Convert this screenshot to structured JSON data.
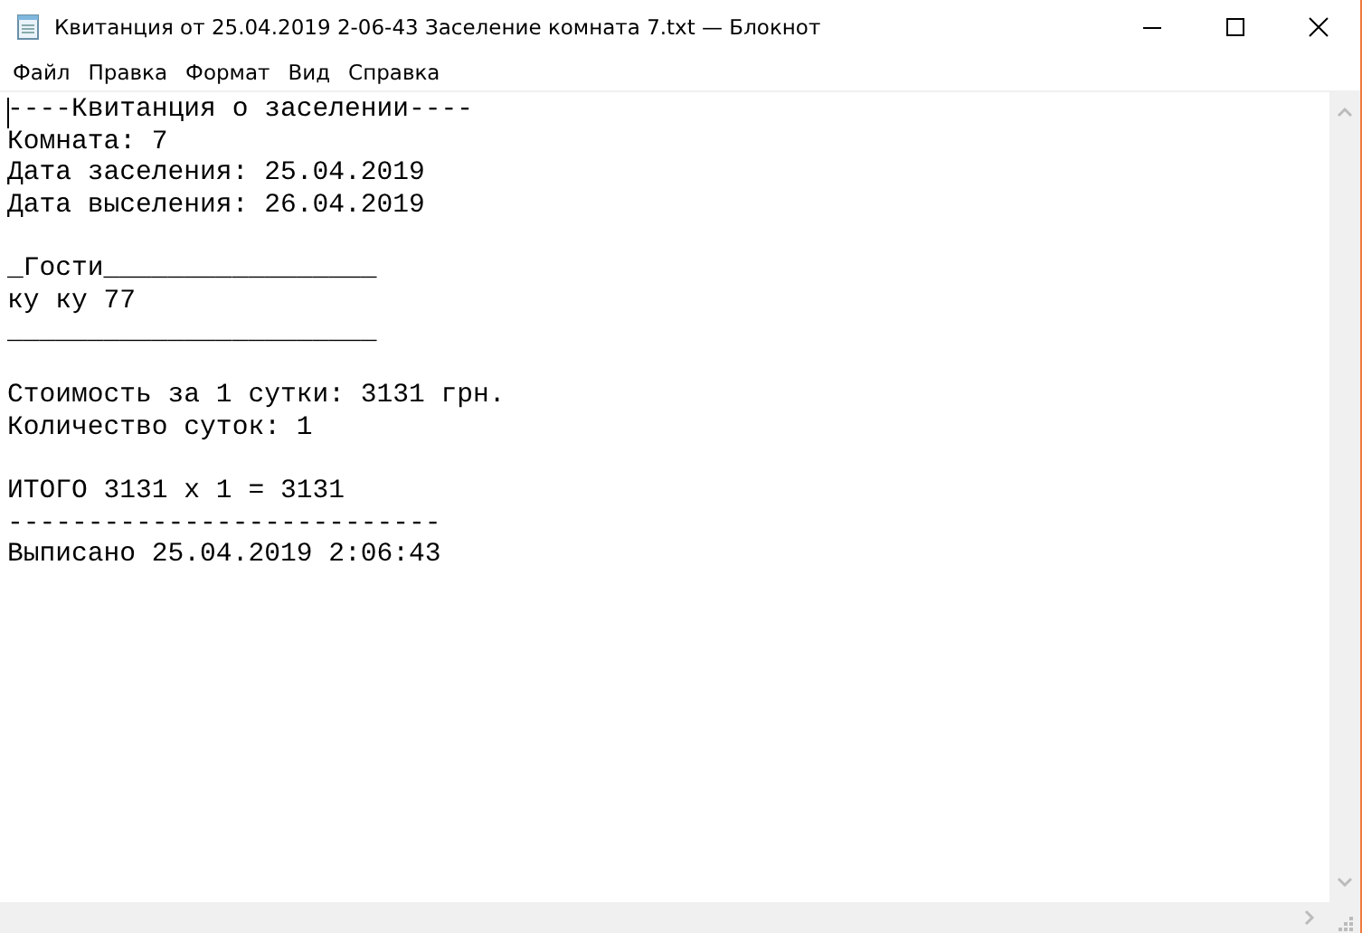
{
  "window": {
    "title": "Квитанция от 25.04.2019 2-06-43 Заселение комната 7.txt — Блокнот"
  },
  "menu": [
    "Файл",
    "Правка",
    "Формат",
    "Вид",
    "Справка"
  ],
  "document": {
    "paragraphs": [
      [
        "----Квитанция о заселении----",
        "Комната: 7",
        "Дата заселения: 25.04.2019",
        "Дата выселения: 26.04.2019"
      ],
      [
        "_Гости_________________",
        "ку ку 77",
        "_______________________"
      ],
      [
        "Стоимость за 1 сутки: 3131 грн.",
        "Количество суток: 1"
      ],
      [
        "ИТОГО 3131 x 1 = 3131",
        "---------------------------",
        "Выписано 25.04.2019 2:06:43"
      ]
    ]
  }
}
